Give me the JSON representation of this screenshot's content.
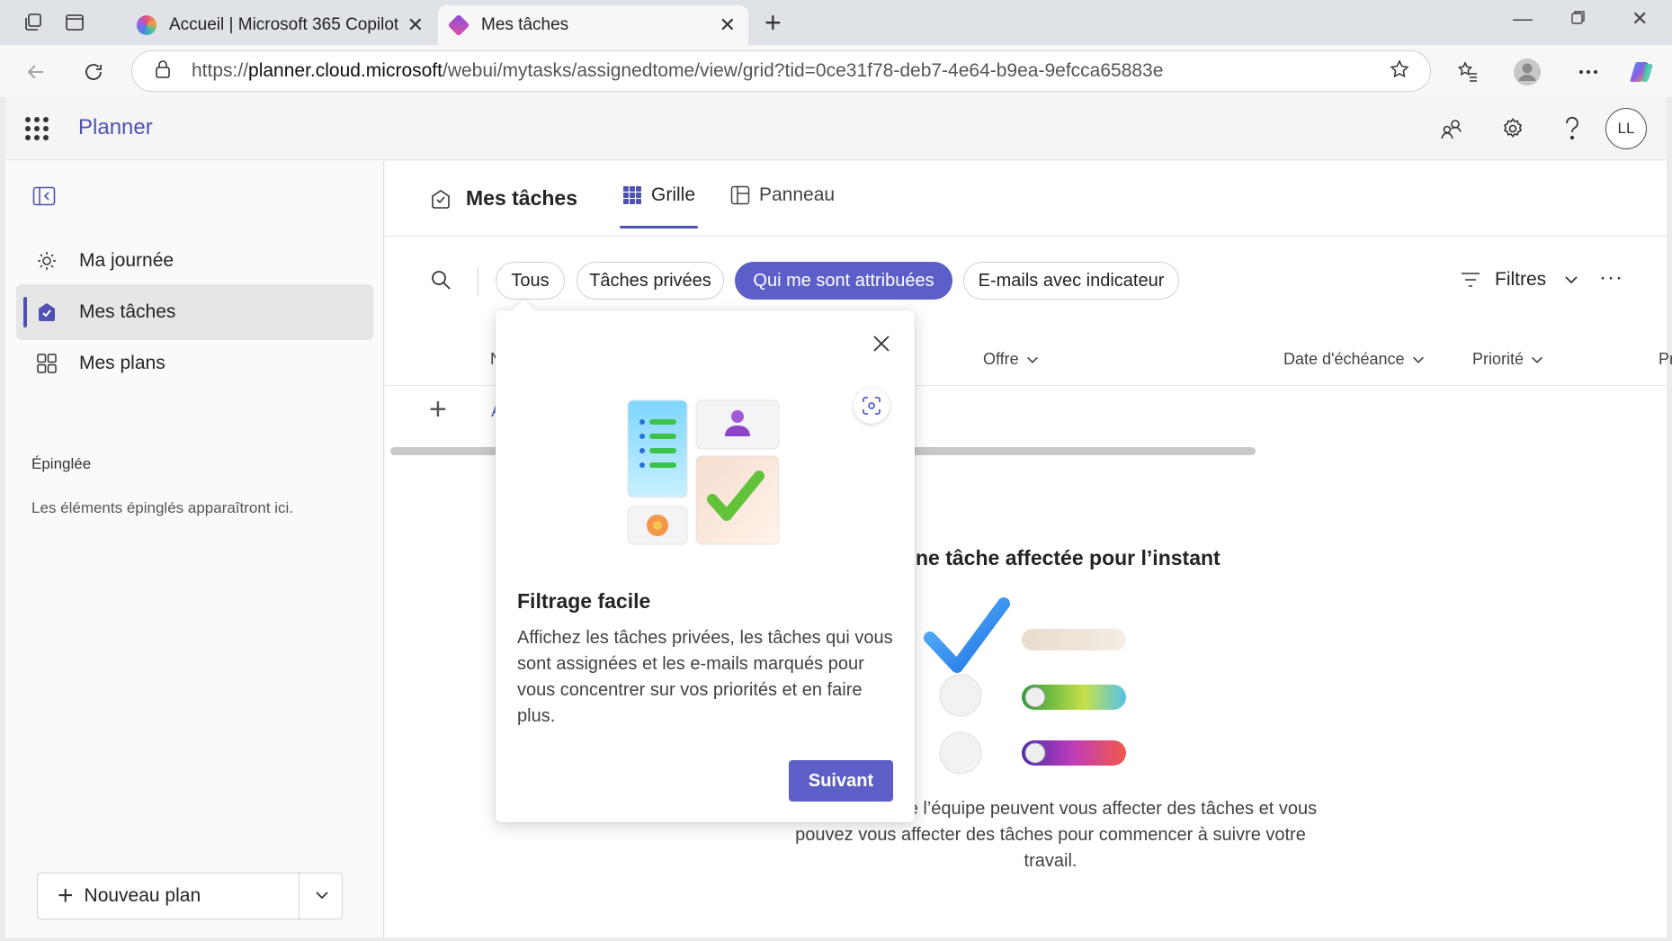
{
  "browser": {
    "tabs": [
      {
        "title": "Accueil | Microsoft 365 Copilot"
      },
      {
        "title": "Mes tâches"
      }
    ],
    "url_prefix": "https://",
    "url_host": "planner.cloud.microsoft",
    "url_path": "/webui/mytasks/assignedtome/view/grid?tid=0ce31f78-deb7-4e64-b9ea-9efcca65883e"
  },
  "app": {
    "name": "Planner",
    "avatar_initials": "LL"
  },
  "sidebar": {
    "items": [
      {
        "label": "Ma journée",
        "icon": "sun-icon"
      },
      {
        "label": "Mes tâches",
        "icon": "tasks-icon"
      },
      {
        "label": "Mes plans",
        "icon": "grid-icon"
      }
    ],
    "pinned_title": "Épinglée",
    "pinned_empty": "Les éléments épinglés apparaîtront ici.",
    "new_plan_label": "Nouveau plan"
  },
  "main": {
    "title": "Mes tâches",
    "view_tabs": [
      {
        "label": "Grille"
      },
      {
        "label": "Panneau"
      }
    ],
    "filter_pills": [
      {
        "label": "Tous"
      },
      {
        "label": "Tâches privées"
      },
      {
        "label": "Qui me sont attribuées"
      },
      {
        "label": "E-mails avec indicateur"
      }
    ],
    "filters_label": "Filtres",
    "columns": {
      "name_partial": "N",
      "offre": "Offre",
      "due": "Date d'échéance",
      "priority": "Priorité",
      "next_partial": "Pr"
    },
    "add_partial": "A",
    "empty_title": "ne tâche affectée pour l’instant",
    "empty_text": "Les membres de l’équipe peuvent vous affecter des tâches et vous pouvez vous affecter des tâches pour commencer à suivre votre travail."
  },
  "popover": {
    "title": "Filtrage facile",
    "body": "Affichez les tâches privées, les tâches qui vous sont assignées et les e-mails marqués pour vous concentrer sur vos priorités et en faire plus.",
    "next_label": "Suivant"
  },
  "colors": {
    "accent": "#5b5fc7",
    "brand_text": "#4f52b2"
  }
}
